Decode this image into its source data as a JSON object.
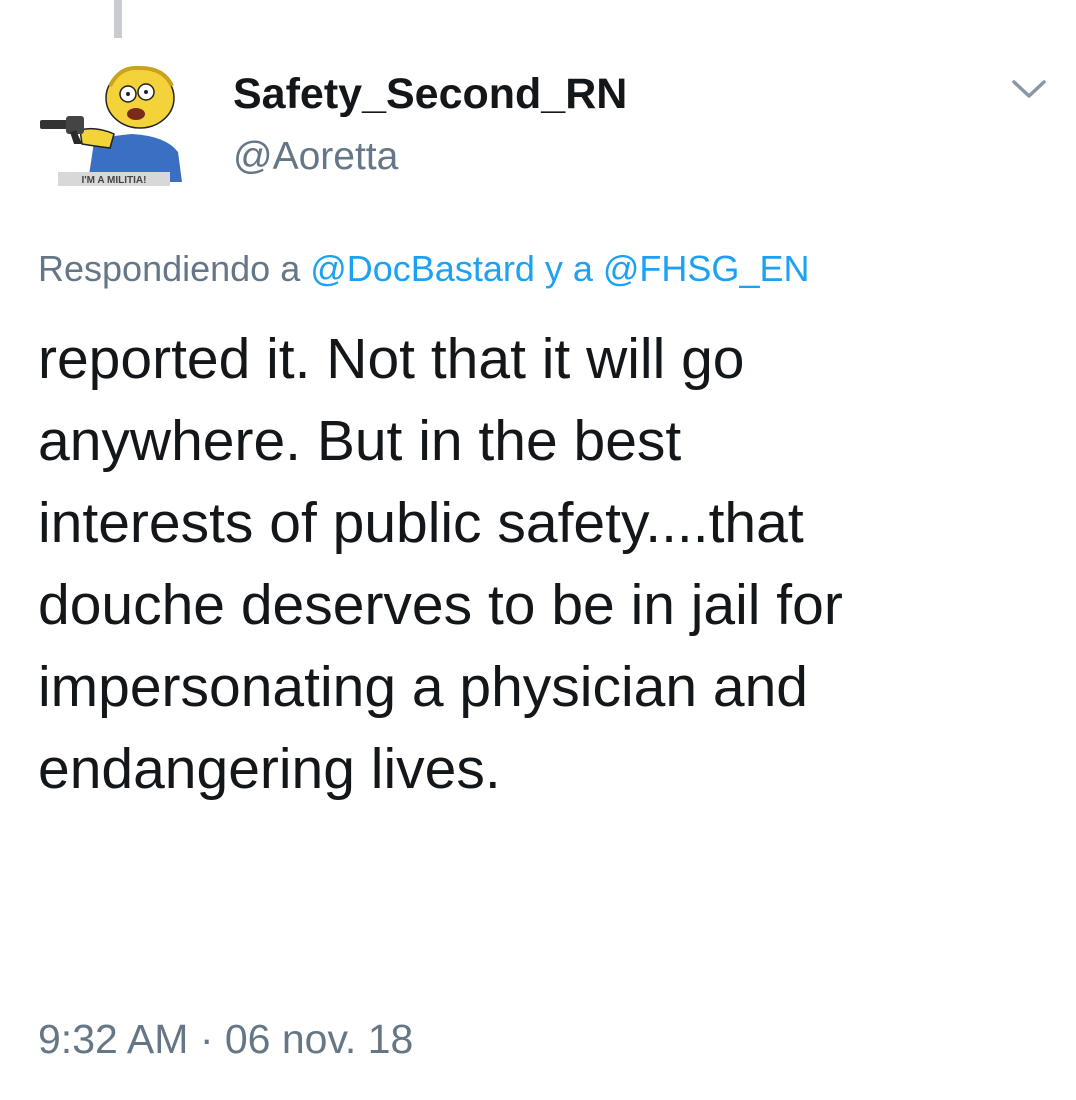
{
  "tweet": {
    "author": {
      "display_name": "Safety_Second_RN",
      "handle": "@Aoretta",
      "avatar_icon": "cartoon-character-avatar",
      "avatar_caption": "I'M A MILITIA!"
    },
    "menu_icon": "chevron-down-icon",
    "reply_context": {
      "prefix": "Respondiendo a ",
      "mention_1": "@DocBastard",
      "joiner": " y a ",
      "mention_2": "@FHSG_EN"
    },
    "text": "reported it.    Not that it will go\nanywhere.  But in the best\ninterests of public safety....that\ndouche deserves to be in jail for\nimpersonating a physician and\nendangering lives.",
    "timestamp": "9:32 AM · 06 nov. 18"
  },
  "colors": {
    "text_primary": "#14171a",
    "text_secondary": "#657786",
    "link": "#1da1f2",
    "thread_line": "#c8ccd0"
  }
}
